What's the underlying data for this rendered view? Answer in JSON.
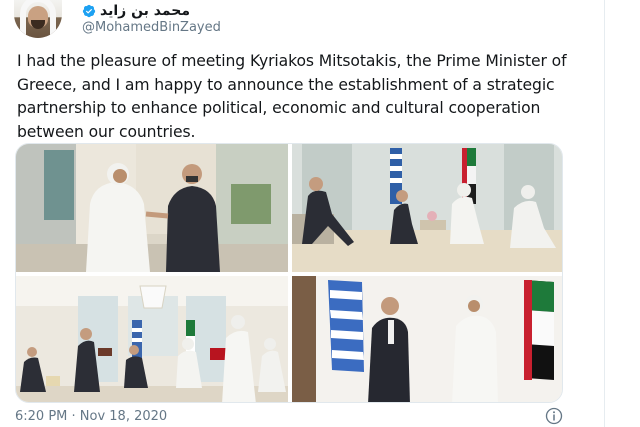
{
  "tweet": {
    "display_name": "محمد بن زايد",
    "handle": "@MohamedBinZayed",
    "verified": true,
    "text": "I had the pleasure of meeting Kyriakos Mitsotakis, the Prime Minister of Greece, and I am happy to announce the establishment of a strategic partnership to enhance political, economic and cultural cooperation between our countries.",
    "timestamp": "6:20 PM · Nov 18, 2020"
  },
  "media": {
    "photos": [
      {
        "alt_name": "photo-greeting-outdoors"
      },
      {
        "alt_name": "photo-seated-meeting"
      },
      {
        "alt_name": "photo-signing-ceremony"
      },
      {
        "alt_name": "photo-standing-flags"
      }
    ]
  },
  "icons": {
    "verified": "verified-badge-icon",
    "info": "info-icon"
  },
  "colors": {
    "text": "#14171a",
    "secondary": "#657786",
    "verified_blue": "#1da1f2",
    "border": "#e1e8ed"
  }
}
